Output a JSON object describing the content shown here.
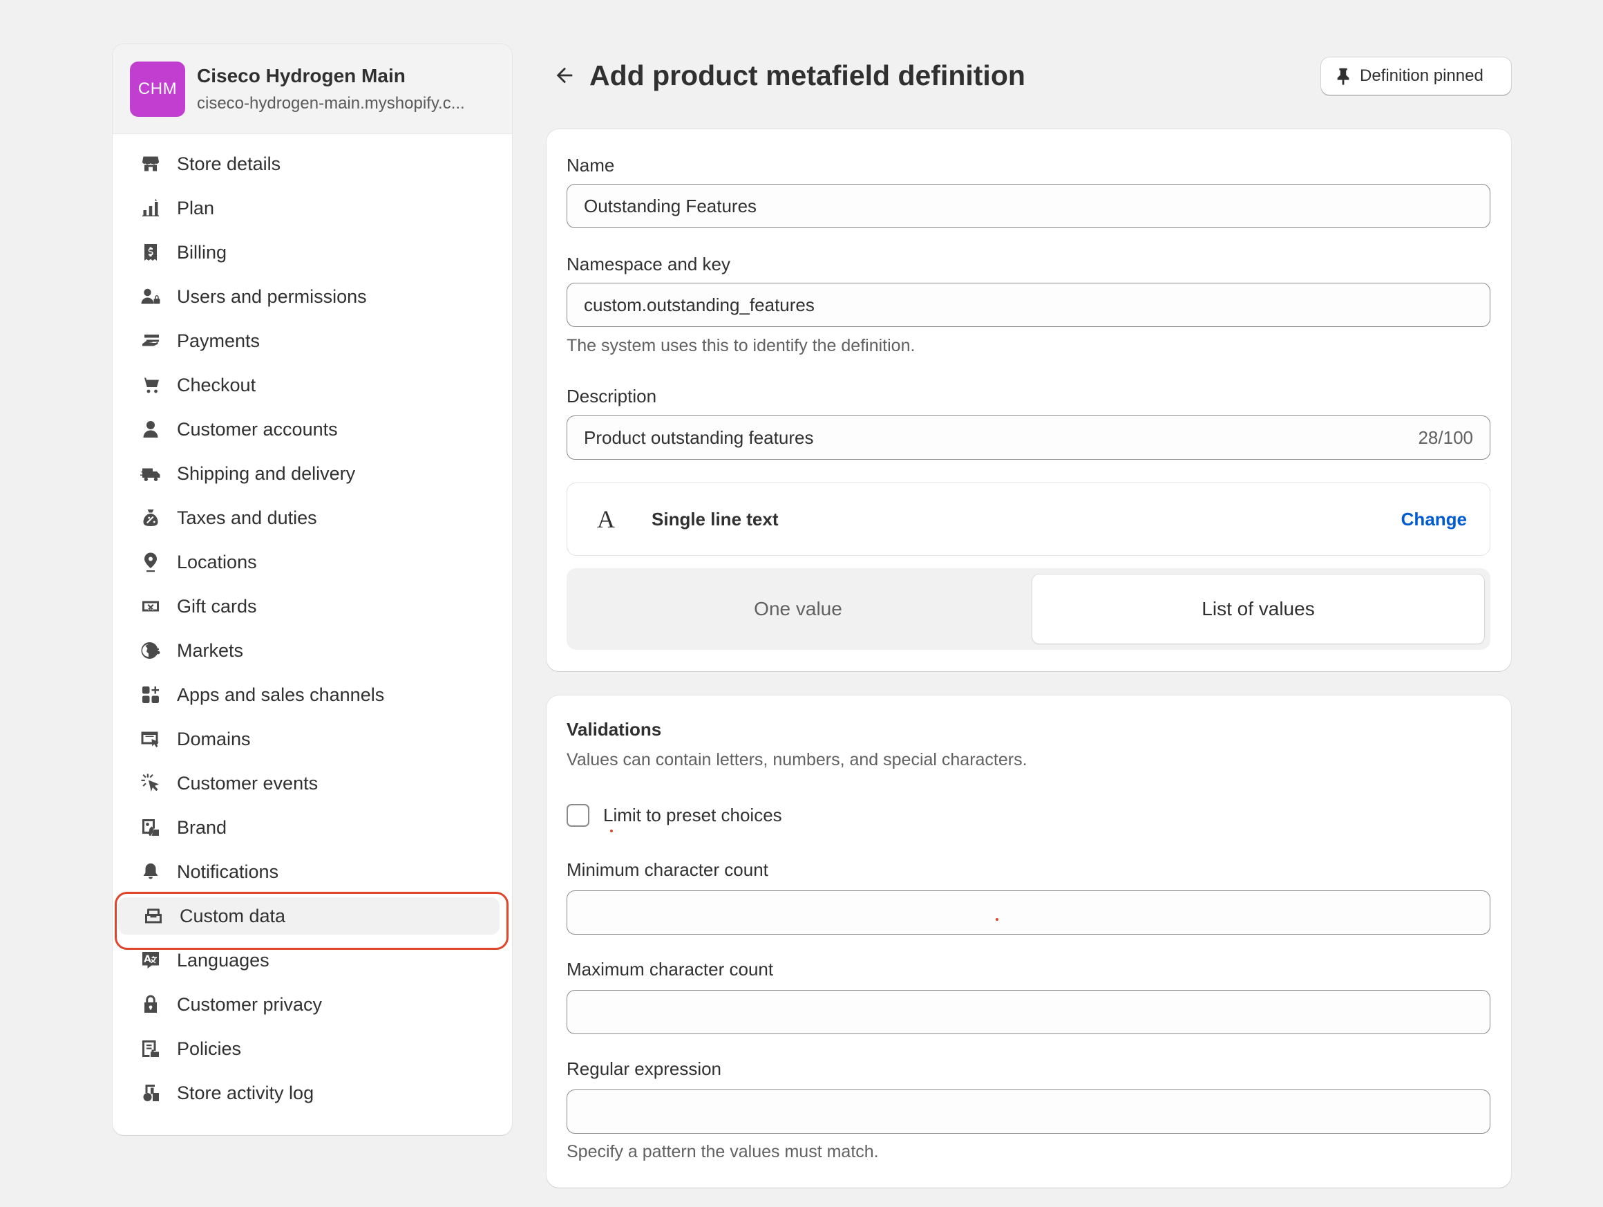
{
  "store": {
    "initials": "CHM",
    "name": "Ciseco Hydrogen Main",
    "domain": "ciseco-hydrogen-main.myshopify.c..."
  },
  "sidebar": {
    "items": [
      {
        "label": "Store details",
        "icon": "store-icon"
      },
      {
        "label": "Plan",
        "icon": "plan-icon"
      },
      {
        "label": "Billing",
        "icon": "billing-icon"
      },
      {
        "label": "Users and permissions",
        "icon": "users-icon"
      },
      {
        "label": "Payments",
        "icon": "payments-icon"
      },
      {
        "label": "Checkout",
        "icon": "cart-icon"
      },
      {
        "label": "Customer accounts",
        "icon": "person-icon"
      },
      {
        "label": "Shipping and delivery",
        "icon": "truck-icon"
      },
      {
        "label": "Taxes and duties",
        "icon": "tax-icon"
      },
      {
        "label": "Locations",
        "icon": "location-icon"
      },
      {
        "label": "Gift cards",
        "icon": "gift-card-icon"
      },
      {
        "label": "Markets",
        "icon": "globe-icon"
      },
      {
        "label": "Apps and sales channels",
        "icon": "apps-icon"
      },
      {
        "label": "Domains",
        "icon": "domains-icon"
      },
      {
        "label": "Customer events",
        "icon": "cursor-icon"
      },
      {
        "label": "Brand",
        "icon": "brand-icon"
      },
      {
        "label": "Notifications",
        "icon": "bell-icon"
      },
      {
        "label": "Custom data",
        "icon": "custom-data-icon",
        "active": true
      },
      {
        "label": "Languages",
        "icon": "languages-icon"
      },
      {
        "label": "Customer privacy",
        "icon": "lock-icon"
      },
      {
        "label": "Policies",
        "icon": "policies-icon"
      },
      {
        "label": "Store activity log",
        "icon": "activity-icon"
      }
    ]
  },
  "header": {
    "title": "Add product metafield definition",
    "pin_label": "Definition pinned"
  },
  "form": {
    "name_label": "Name",
    "name_value": "Outstanding Features",
    "namespace_label": "Namespace and key",
    "namespace_value": "custom.outstanding_features",
    "namespace_help": "The system uses this to identify the definition.",
    "description_label": "Description",
    "description_value": "Product outstanding features",
    "description_counter": "28/100",
    "type_icon": "A",
    "type_label": "Single line text",
    "change_label": "Change",
    "one_value_label": "One value",
    "list_values_label": "List of values",
    "selected_option": "List of values"
  },
  "validations": {
    "title": "Validations",
    "subtitle": "Values can contain letters, numbers, and special characters.",
    "limit_label": "Limit to preset choices",
    "limit_checked": false,
    "min_label": "Minimum character count",
    "min_value": "",
    "max_label": "Maximum character count",
    "max_value": "",
    "regex_label": "Regular expression",
    "regex_value": "",
    "regex_help": "Specify a pattern the values must match."
  },
  "colors": {
    "highlight": "#e0442a",
    "avatar": "#c23ed0",
    "link": "#005bd3"
  }
}
